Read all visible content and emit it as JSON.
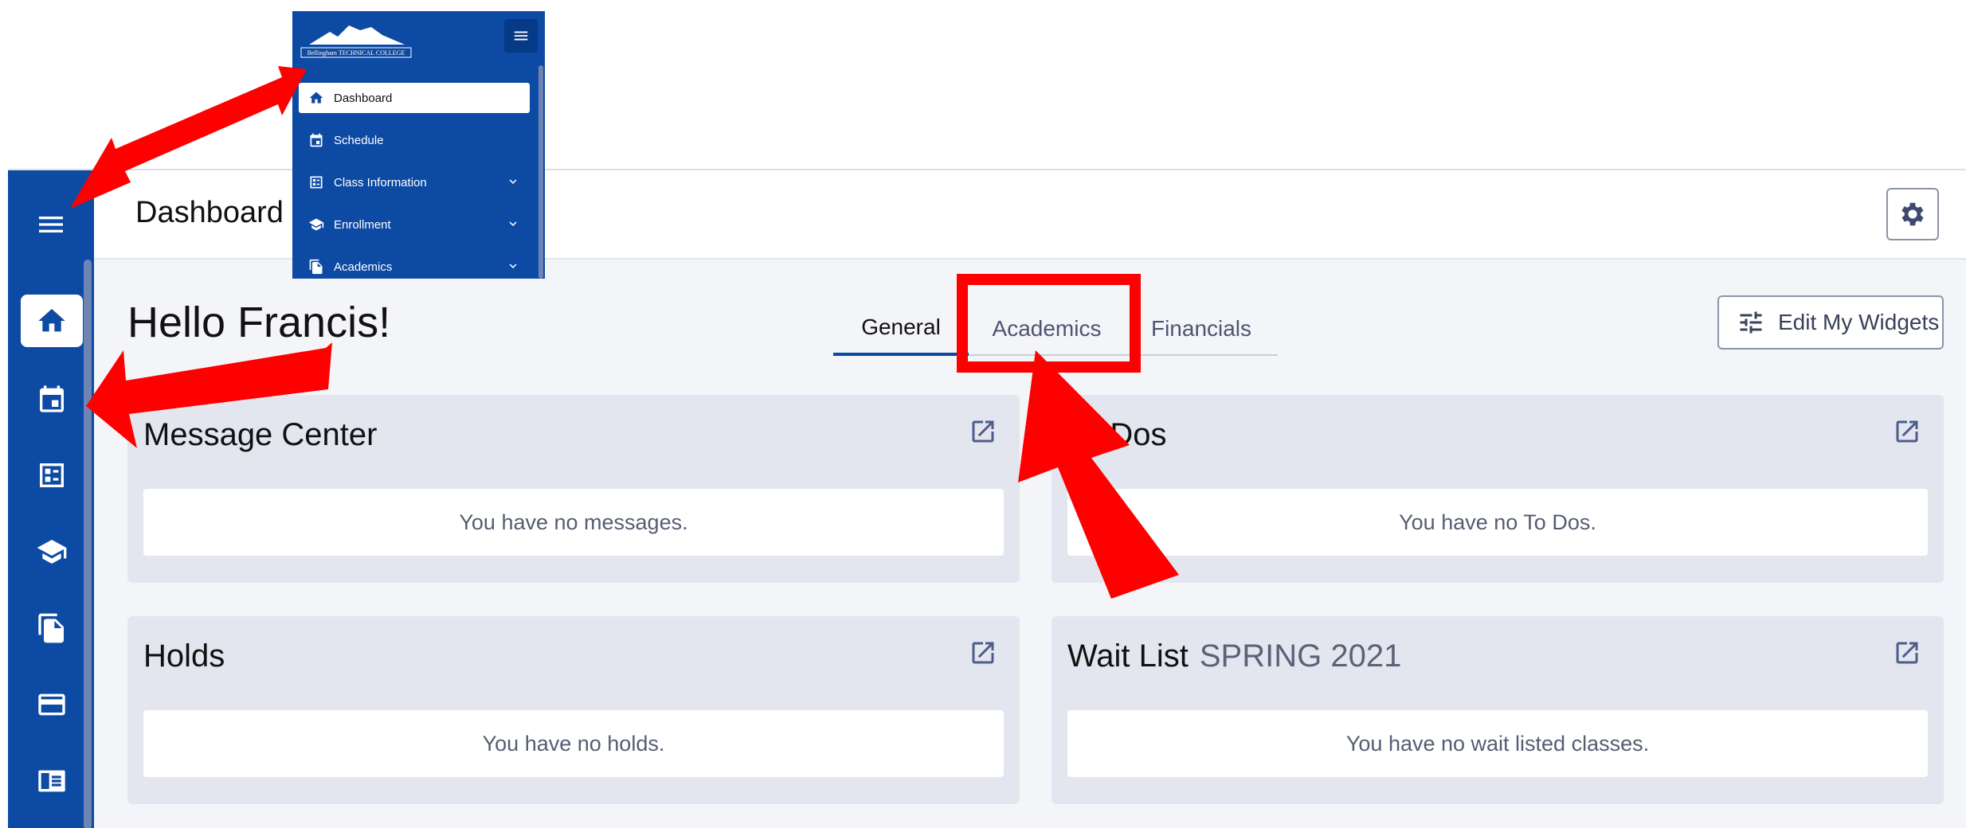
{
  "header": {
    "title": "Dashboard",
    "settings_icon": "gear-icon"
  },
  "greeting": "Hello Francis!",
  "tabs": [
    {
      "label": "General",
      "active": true
    },
    {
      "label": "Academics",
      "active": false
    },
    {
      "label": "Financials",
      "active": false
    }
  ],
  "edit_widgets": {
    "label": "Edit My Widgets",
    "icon": "sliders-icon"
  },
  "cards": [
    {
      "title": "Message Center",
      "subtitle": "",
      "body": "You have no messages."
    },
    {
      "title": "To Dos",
      "subtitle": "",
      "body": "You have no To Dos."
    },
    {
      "title": "Holds",
      "subtitle": "",
      "body": "You have no holds."
    },
    {
      "title": "Wait List",
      "subtitle": "SPRING 2021",
      "body": "You have no wait listed classes."
    }
  ],
  "rail_icons": [
    "menu-icon",
    "home-icon",
    "calendar-icon",
    "class-info-icon",
    "graduation-cap-icon",
    "documents-icon",
    "credit-card-icon",
    "book-icon"
  ],
  "inset": {
    "logo_text": "Bellingham TECHNICAL COLLEGE",
    "items": [
      {
        "label": "Dashboard",
        "icon": "home-icon",
        "active": true,
        "expandable": false
      },
      {
        "label": "Schedule",
        "icon": "calendar-icon",
        "active": false,
        "expandable": false
      },
      {
        "label": "Class Information",
        "icon": "class-info-icon",
        "active": false,
        "expandable": true
      },
      {
        "label": "Enrollment",
        "icon": "graduation-cap-icon",
        "active": false,
        "expandable": true
      },
      {
        "label": "Academics",
        "icon": "documents-icon",
        "active": false,
        "expandable": true
      }
    ]
  },
  "colors": {
    "brand_blue": "#0d4aa3",
    "annotation_red": "#ff0000",
    "background": "#f4f5f9",
    "card": "#e4e6ef"
  }
}
